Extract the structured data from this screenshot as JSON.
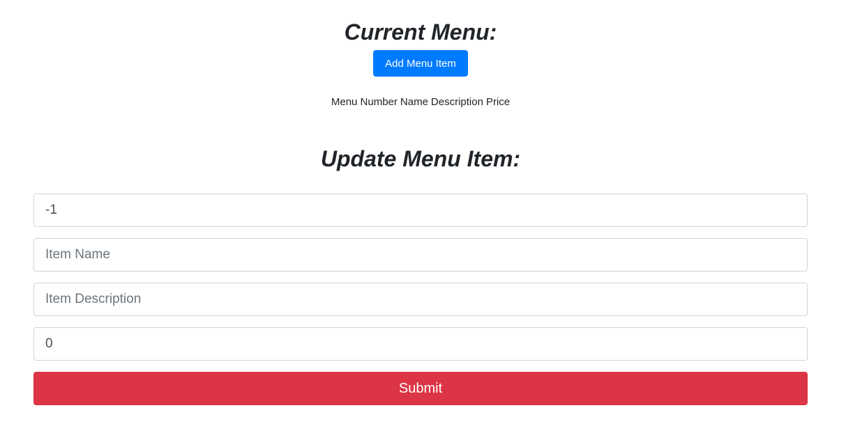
{
  "current_menu": {
    "title": "Current Menu:",
    "add_button_label": "Add Menu Item",
    "table": {
      "columns": [
        "Menu Number",
        "Name",
        "Description",
        "Price"
      ],
      "rows": []
    }
  },
  "update_form": {
    "title": "Update Menu Item:",
    "menu_number": {
      "value": "-1",
      "placeholder": ""
    },
    "item_name": {
      "value": "",
      "placeholder": "Item Name"
    },
    "item_description": {
      "value": "",
      "placeholder": "Item Description"
    },
    "price": {
      "value": "0",
      "placeholder": ""
    },
    "submit_label": "Submit"
  },
  "colors": {
    "primary": "#007bff",
    "danger": "#dc3545",
    "border": "#ced4da",
    "text": "#212529"
  }
}
